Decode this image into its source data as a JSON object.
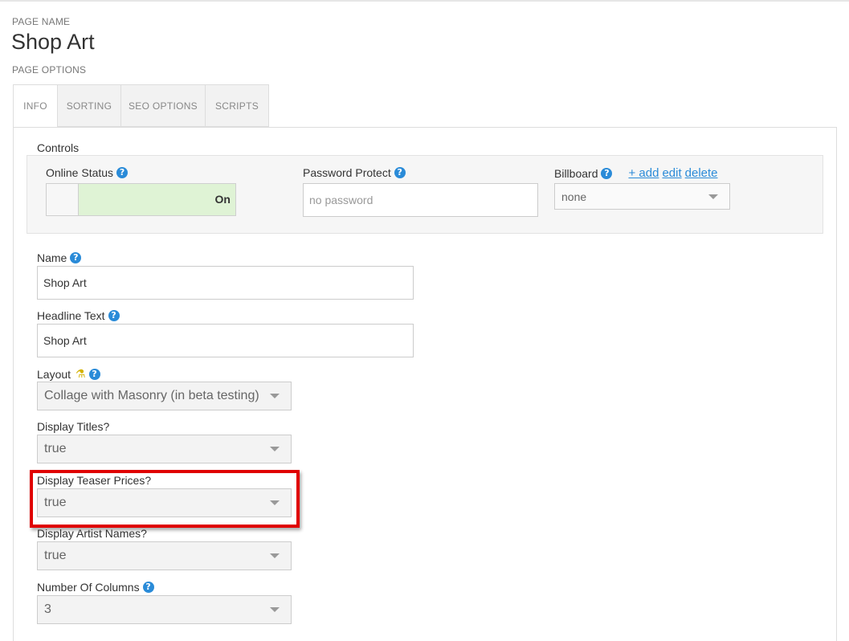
{
  "header": {
    "page_name_label": "PAGE NAME",
    "page_title": "Shop Art",
    "page_options_label": "PAGE OPTIONS"
  },
  "tabs": [
    {
      "label": "INFO",
      "active": true
    },
    {
      "label": "SORTING",
      "active": false
    },
    {
      "label": "SEO OPTIONS",
      "active": false
    },
    {
      "label": "SCRIPTS",
      "active": false
    }
  ],
  "controls": {
    "title": "Controls",
    "online_status": {
      "label": "Online Status",
      "value": "On",
      "help_icon": "question-circle-icon"
    },
    "password_protect": {
      "label": "Password Protect",
      "value": "",
      "placeholder": "no password",
      "help_icon": "question-circle-icon"
    },
    "billboard": {
      "label": "Billboard",
      "selected": "none",
      "links": [
        "+ add",
        "edit",
        "delete"
      ],
      "help_icon": "question-circle-icon"
    }
  },
  "fields": {
    "name": {
      "label": "Name",
      "value": "Shop Art"
    },
    "headline_text": {
      "label": "Headline Text",
      "value": "Shop Art"
    },
    "layout": {
      "label": "Layout",
      "selected": "Collage with Masonry (in beta testing)",
      "beta_icon": "flask-icon"
    },
    "display_titles": {
      "label": "Display Titles?",
      "selected": "true"
    },
    "display_teaser_prices": {
      "label": "Display Teaser Prices?",
      "selected": "true"
    },
    "display_artist_names": {
      "label": "Display Artist Names?",
      "selected": "true"
    },
    "number_of_columns": {
      "label": "Number Of Columns",
      "selected": "3"
    }
  },
  "colors": {
    "accent": "#2a8bd8",
    "toggle_on": "#dff3d5",
    "highlight_border": "#e00000",
    "beta_icon": "#d4b200"
  }
}
